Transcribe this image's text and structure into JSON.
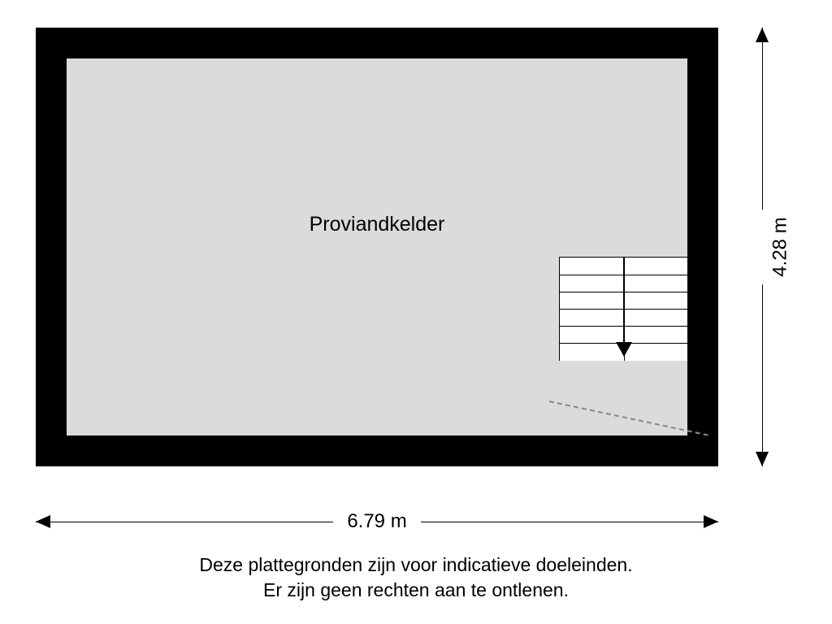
{
  "room": {
    "label": "Proviandkelder"
  },
  "dimensions": {
    "width_label": "6.79 m",
    "height_label": "4.28 m"
  },
  "disclaimer": {
    "line1": "Deze plattegronden zijn voor indicatieve doeleinden.",
    "line2": "Er zijn geen rechten aan te ontlenen."
  }
}
